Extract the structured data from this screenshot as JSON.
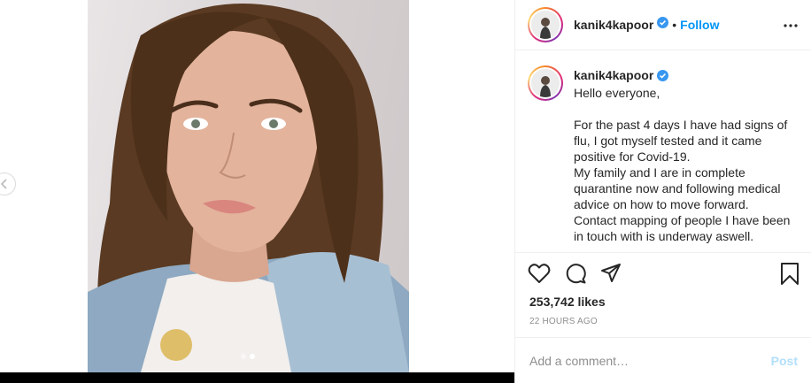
{
  "post": {
    "username": "kanik4kapoor",
    "follow_label": "Follow",
    "separator": "•",
    "caption": {
      "username": "kanik4kapoor",
      "text": "Hello everyone,\n\nFor the past 4 days I have had signs of flu, I got myself tested and it came positive for Covid-19.\nMy family and I are in complete quarantine now and following medical advice on how to move forward.\nContact mapping of people I have been in touch with is underway aswell."
    },
    "likes": "253,742 likes",
    "timestamp": "22 HOURS AGO"
  },
  "comment": {
    "placeholder": "Add a comment…",
    "post_label": "Post"
  },
  "media": {
    "slide_count": 2,
    "active_slide": 2
  },
  "colors": {
    "accent": "#0095f6",
    "verified": "#3897f0",
    "post_disabled": "#b2dffc",
    "muted": "#8e8e8e"
  },
  "icons": [
    "chevron-left-icon",
    "verified-badge-icon",
    "more-options-icon",
    "heart-icon",
    "comment-icon",
    "share-icon",
    "bookmark-icon"
  ]
}
